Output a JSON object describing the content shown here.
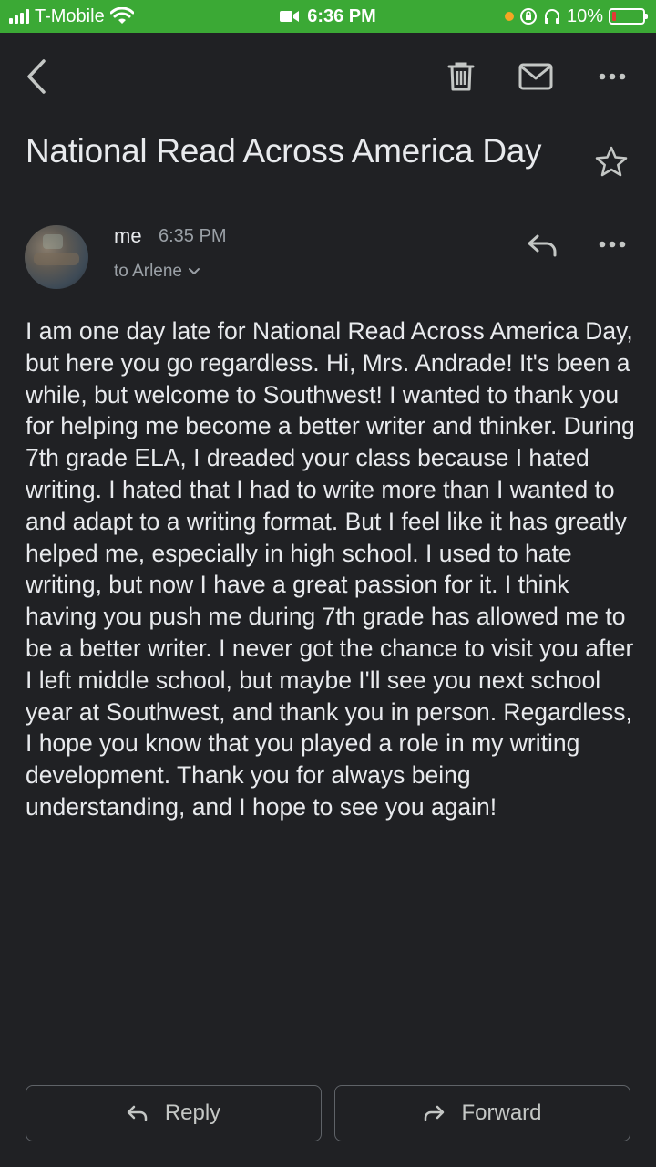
{
  "status_bar": {
    "carrier": "T-Mobile",
    "time": "6:36 PM",
    "battery": "10%"
  },
  "toolbar": {
    "back_icon": "back-arrow-icon",
    "delete_icon": "trash-icon",
    "mark_unread_icon": "mail-icon",
    "more_icon": "more-icon"
  },
  "email": {
    "subject": "National Read Across America Day",
    "sender": "me",
    "time": "6:35 PM",
    "recipient": "to Arlene",
    "body": "I am one day late for National Read Across America Day, but here you go regardless. Hi, Mrs. Andrade! It's been a while, but welcome to Southwest! I wanted to thank you for helping me become a better writer and thinker. During 7th grade ELA, I dreaded your class because I hated writing. I hated that I had to write more than I wanted to and adapt to a writing format. But I feel like it has greatly helped me, especially in high school. I used to hate writing, but now I have a great passion for it. I think having you push me during 7th grade has allowed me to be a better writer. I never got the chance to visit you after I left middle school, but maybe I'll see you next school year at Southwest, and thank you in person. Regardless, I hope you know that you played a role in my writing development. Thank you for always being understanding, and I hope to see you again!"
  },
  "actions": {
    "reply_label": "Reply",
    "forward_label": "Forward"
  },
  "colors": {
    "background": "#202124",
    "status_bar": "#3ba935",
    "text": "#e8eaed",
    "muted": "#9aa0a6"
  }
}
